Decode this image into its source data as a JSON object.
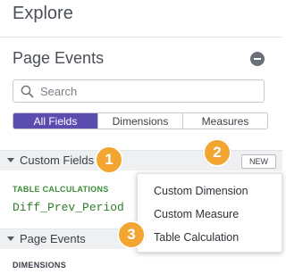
{
  "panel": {
    "title": "Explore"
  },
  "section": {
    "title": "Page Events"
  },
  "search": {
    "placeholder": "Search",
    "value": ""
  },
  "tabs": [
    {
      "label": "All Fields",
      "active": true
    },
    {
      "label": "Dimensions",
      "active": false
    },
    {
      "label": "Measures",
      "active": false
    }
  ],
  "groups": {
    "custom_fields": {
      "label": "Custom Fields",
      "subheading": "TABLE CALCULATIONS",
      "items": [
        "Diff_Prev_Period"
      ]
    },
    "page_events": {
      "label": "Page Events",
      "subheading": "DIMENSIONS"
    }
  },
  "new_button": {
    "label": "NEW"
  },
  "menu": {
    "items": [
      "Custom Dimension",
      "Custom Measure",
      "Table Calculation"
    ]
  },
  "badges": [
    "1",
    "2",
    "3"
  ],
  "colors": {
    "accent": "#5b4caf",
    "badge": "#f2a531",
    "field_green": "#2f7d2c"
  }
}
